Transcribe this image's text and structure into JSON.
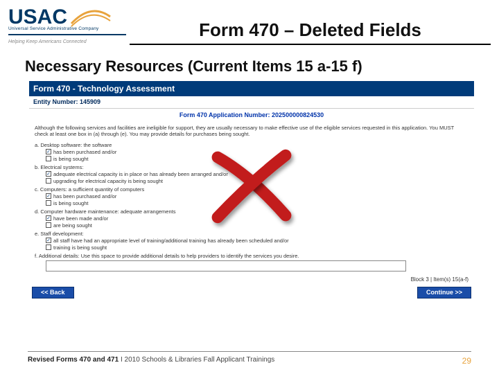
{
  "logo": {
    "main": "USAC",
    "sub": "Universal Service Administrative Company",
    "tagline": "Helping Keep Americans Connected"
  },
  "title": "Form 470 – Deleted Fields",
  "section_heading": "Necessary Resources (Current Items 15 a-15 f)",
  "form": {
    "header": "Form 470 - Technology Assessment",
    "entity_label": "Entity Number: 145909",
    "app_num": "Form 470 Application Number: 202500000824530",
    "intro": "Although the following services and facilities are ineligible for support, they are usually necessary to make effective use of the eligible services requested in this application. You MUST check at least one box in (a) through (e). You may provide details for purchases being sought.",
    "items": {
      "a_label": "a. Desktop software: the software",
      "a_1": "has been purchased and/or",
      "a_2": "is being sought",
      "b_label": "b. Electrical systems:",
      "b_1": "adequate electrical capacity is in place or has already been arranged and/or",
      "b_2": "upgrading for electrical capacity is being sought",
      "c_label": "c. Computers: a sufficient quantity of computers",
      "c_1": "has been purchased and/or",
      "c_2": "is being sought",
      "d_label": "d. Computer hardware maintenance: adequate arrangements",
      "d_1": "have been made and/or",
      "d_2": "are being sought",
      "e_label": "e. Staff development:",
      "e_1": "all staff have had an appropriate level of training/additional training has already been scheduled and/or",
      "e_2": "training is being sought",
      "f_label": "f. Additional details: Use this space to provide additional details to help providers to identify the services you desire."
    },
    "block_label": "Block 3 | Item(s) 15(a-f)",
    "back": "<< Back",
    "cont": "Continue >>"
  },
  "footer": {
    "left_bold": "Revised Forms 470 and 471",
    "left_rest": " I 2010 Schools & Libraries Fall Applicant Trainings",
    "page": "29"
  }
}
